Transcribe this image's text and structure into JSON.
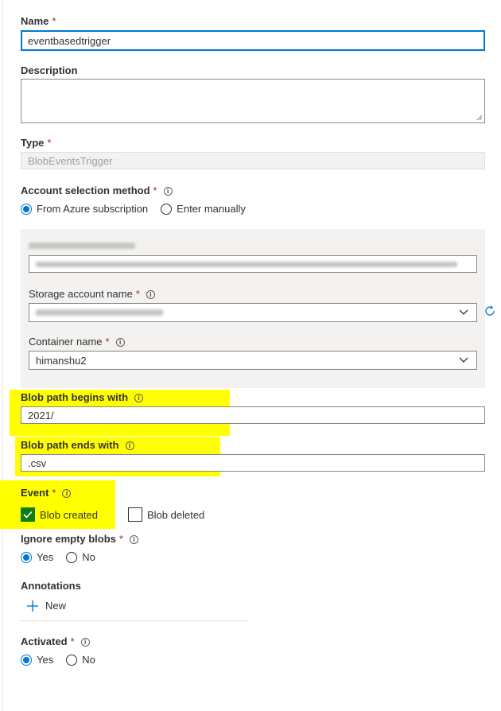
{
  "form": {
    "name": {
      "label": "Name",
      "value": "eventbasedtrigger"
    },
    "description": {
      "label": "Description",
      "value": ""
    },
    "type": {
      "label": "Type",
      "placeholder": "BlobEventsTrigger"
    },
    "account_selection": {
      "label": "Account selection method",
      "options": [
        "From Azure subscription",
        "Enter manually"
      ],
      "selected": "From Azure subscription"
    },
    "storage_account": {
      "label": "Storage account name"
    },
    "container": {
      "label": "Container name",
      "value": "himanshu2"
    },
    "blob_begins": {
      "label": "Blob path begins with",
      "value": "2021/"
    },
    "blob_ends": {
      "label": "Blob path ends with",
      "value": ".csv"
    },
    "event": {
      "label": "Event",
      "options": [
        {
          "label": "Blob created",
          "checked": true
        },
        {
          "label": "Blob deleted",
          "checked": false
        }
      ]
    },
    "ignore_empty": {
      "label": "Ignore empty blobs",
      "options": [
        "Yes",
        "No"
      ],
      "selected": "Yes"
    },
    "annotations": {
      "label": "Annotations",
      "new_label": "New"
    },
    "activated": {
      "label": "Activated",
      "options": [
        "Yes",
        "No"
      ],
      "selected": "Yes"
    }
  },
  "required_mark": "*",
  "colors": {
    "accent": "#0078d4",
    "required": "#a4262c",
    "highlight": "#ffff00",
    "checked": "#107c10"
  }
}
